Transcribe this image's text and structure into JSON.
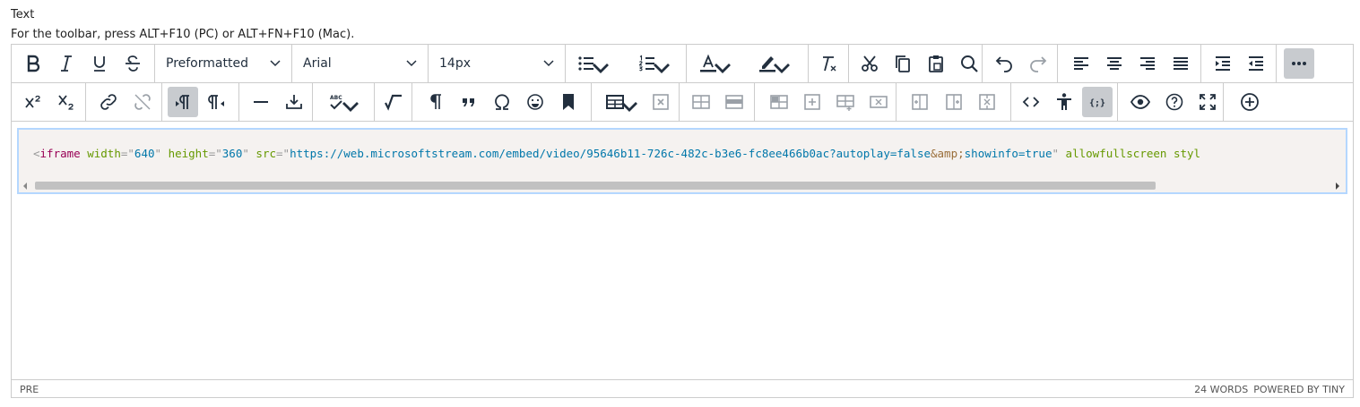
{
  "field": {
    "label": "Text",
    "hint": "For the toolbar, press ALT+F10 (PC) or ALT+FN+F10 (Mac)."
  },
  "toolbar": {
    "block_format": "Preformatted",
    "font_family": "Arial",
    "font_size": "14px",
    "text_color": "#222f3e",
    "highlight_color": "#222f3e"
  },
  "content": {
    "code_tokens": [
      {
        "t": "<",
        "c": "punct"
      },
      {
        "t": "iframe",
        "c": "tag"
      },
      {
        "t": " ",
        "c": "plain"
      },
      {
        "t": "width",
        "c": "attr"
      },
      {
        "t": "=\"",
        "c": "punct"
      },
      {
        "t": "640",
        "c": "val"
      },
      {
        "t": "\"",
        "c": "punct"
      },
      {
        "t": " ",
        "c": "plain"
      },
      {
        "t": "height",
        "c": "attr"
      },
      {
        "t": "=\"",
        "c": "punct"
      },
      {
        "t": "360",
        "c": "val"
      },
      {
        "t": "\"",
        "c": "punct"
      },
      {
        "t": " ",
        "c": "plain"
      },
      {
        "t": "src",
        "c": "attr"
      },
      {
        "t": "=\"",
        "c": "punct"
      },
      {
        "t": "https://web.microsoftstream.com/embed/video/95646b11-726c-482c-b3e6-fc8ee466b0ac?autoplay=false",
        "c": "val"
      },
      {
        "t": "&amp;",
        "c": "ent"
      },
      {
        "t": "showinfo=true",
        "c": "val"
      },
      {
        "t": "\"",
        "c": "punct"
      },
      {
        "t": " ",
        "c": "plain"
      },
      {
        "t": "allowfullscreen",
        "c": "attr"
      },
      {
        "t": " ",
        "c": "plain"
      },
      {
        "t": "styl",
        "c": "attr"
      }
    ]
  },
  "status": {
    "path": "PRE",
    "word_count": "24 WORDS",
    "powered_by": "POWERED BY TINY"
  },
  "icons": {
    "row1": [
      "bold-icon",
      "italic-icon",
      "underline-icon",
      "strikethrough-icon",
      "bullet-list-icon",
      "numbered-list-icon",
      "text-color-icon",
      "highlight-icon",
      "clear-formatting-icon",
      "cut-icon",
      "copy-icon",
      "paste-icon",
      "search-icon",
      "undo-icon",
      "redo-icon",
      "align-left-icon",
      "align-center-icon",
      "align-right-icon",
      "justify-icon",
      "indent-icon",
      "outdent-icon",
      "more-icon"
    ],
    "row2": [
      "superscript-icon",
      "subscript-icon",
      "link-icon",
      "unlink-icon",
      "ltr-icon",
      "rtl-icon",
      "horizontal-line-icon",
      "insert-icon",
      "spellcheck-icon",
      "equation-icon",
      "paragraph-icon",
      "blockquote-icon",
      "omega-icon",
      "emoji-icon",
      "bookmark-icon",
      "table-icon",
      "delete-table-icon",
      "code-icon",
      "accessibility-icon",
      "code-sample-icon",
      "preview-icon",
      "help-icon",
      "fullscreen-icon",
      "add-icon"
    ]
  }
}
